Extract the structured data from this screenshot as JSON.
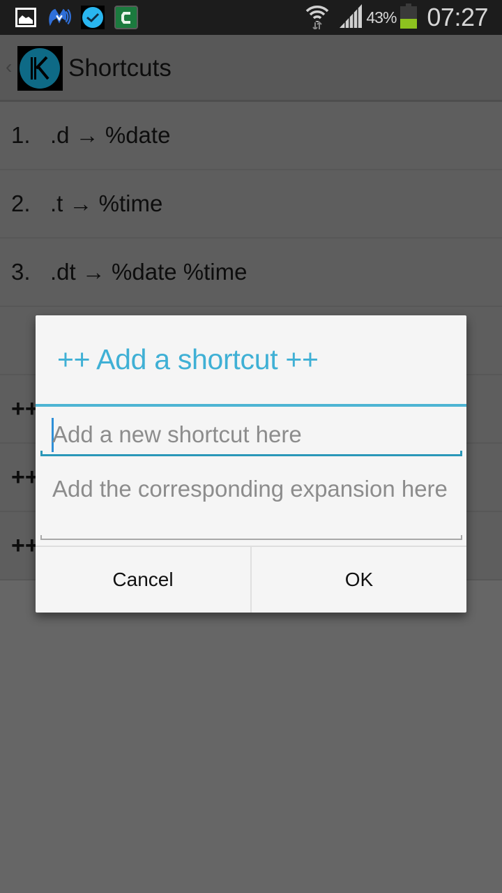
{
  "status_bar": {
    "notification_icons": [
      "gallery-icon",
      "malwarebytes-icon",
      "clock-check-icon",
      "c-app-icon"
    ],
    "wifi": "wifi-icon",
    "signal": "signal-icon",
    "battery_percent": "43%",
    "battery_level": 0.43,
    "battery_color": "#8dc21f",
    "time": "07:27"
  },
  "action_bar": {
    "back_icon": "chevron-left-icon",
    "app_icon": "k-logo-icon",
    "app_icon_color": "#0e6a86",
    "title": "Shortcuts"
  },
  "list": {
    "items": [
      {
        "number": "1.",
        "text": ".d → %date"
      },
      {
        "number": "2.",
        "text": ".t → %time"
      },
      {
        "number": "3.",
        "text": ".dt → %date %time"
      },
      {
        "number": "",
        "text": ""
      },
      {
        "number": "",
        "text": "++"
      },
      {
        "number": "",
        "text": "++"
      },
      {
        "number": "",
        "text": "++"
      }
    ]
  },
  "dialog": {
    "title": "++ Add a shortcut ++",
    "accent_color": "#3fb0d5",
    "shortcut_field": {
      "value": "",
      "placeholder": "Add a new shortcut here"
    },
    "expansion_field": {
      "value": "",
      "placeholder": "Add the corresponding expansion here"
    },
    "cancel_label": "Cancel",
    "ok_label": "OK"
  }
}
